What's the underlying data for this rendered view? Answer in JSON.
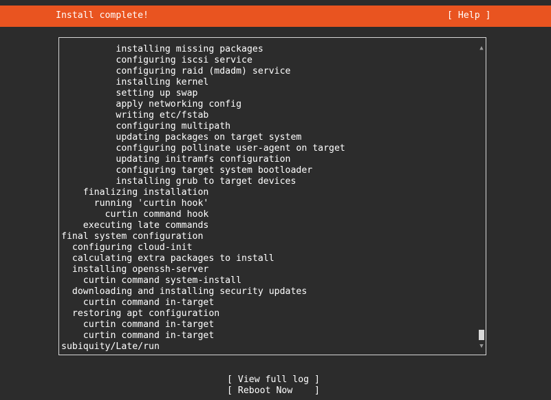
{
  "header": {
    "title": "Install complete!",
    "help_label": "[ Help ]"
  },
  "log": {
    "lines": [
      "          installing missing packages",
      "          configuring iscsi service",
      "          configuring raid (mdadm) service",
      "          installing kernel",
      "          setting up swap",
      "          apply networking config",
      "          writing etc/fstab",
      "          configuring multipath",
      "          updating packages on target system",
      "          configuring pollinate user-agent on target",
      "          updating initramfs configuration",
      "          configuring target system bootloader",
      "          installing grub to target devices",
      "    finalizing installation",
      "      running 'curtin hook'",
      "        curtin command hook",
      "    executing late commands",
      "final system configuration",
      "  configuring cloud-init",
      "  calculating extra packages to install",
      "  installing openssh-server",
      "    curtin command system-install",
      "  downloading and installing security updates",
      "    curtin command in-target",
      "  restoring apt configuration",
      "    curtin command in-target",
      "    curtin command in-target",
      "subiquity/Late/run"
    ]
  },
  "actions": {
    "view_full_log": "[ View full log ]",
    "reboot_now": "[ Reboot Now    ]"
  },
  "colors": {
    "header_bg": "#e95420",
    "body_bg": "#2c2c2c",
    "text": "#ffffff"
  }
}
